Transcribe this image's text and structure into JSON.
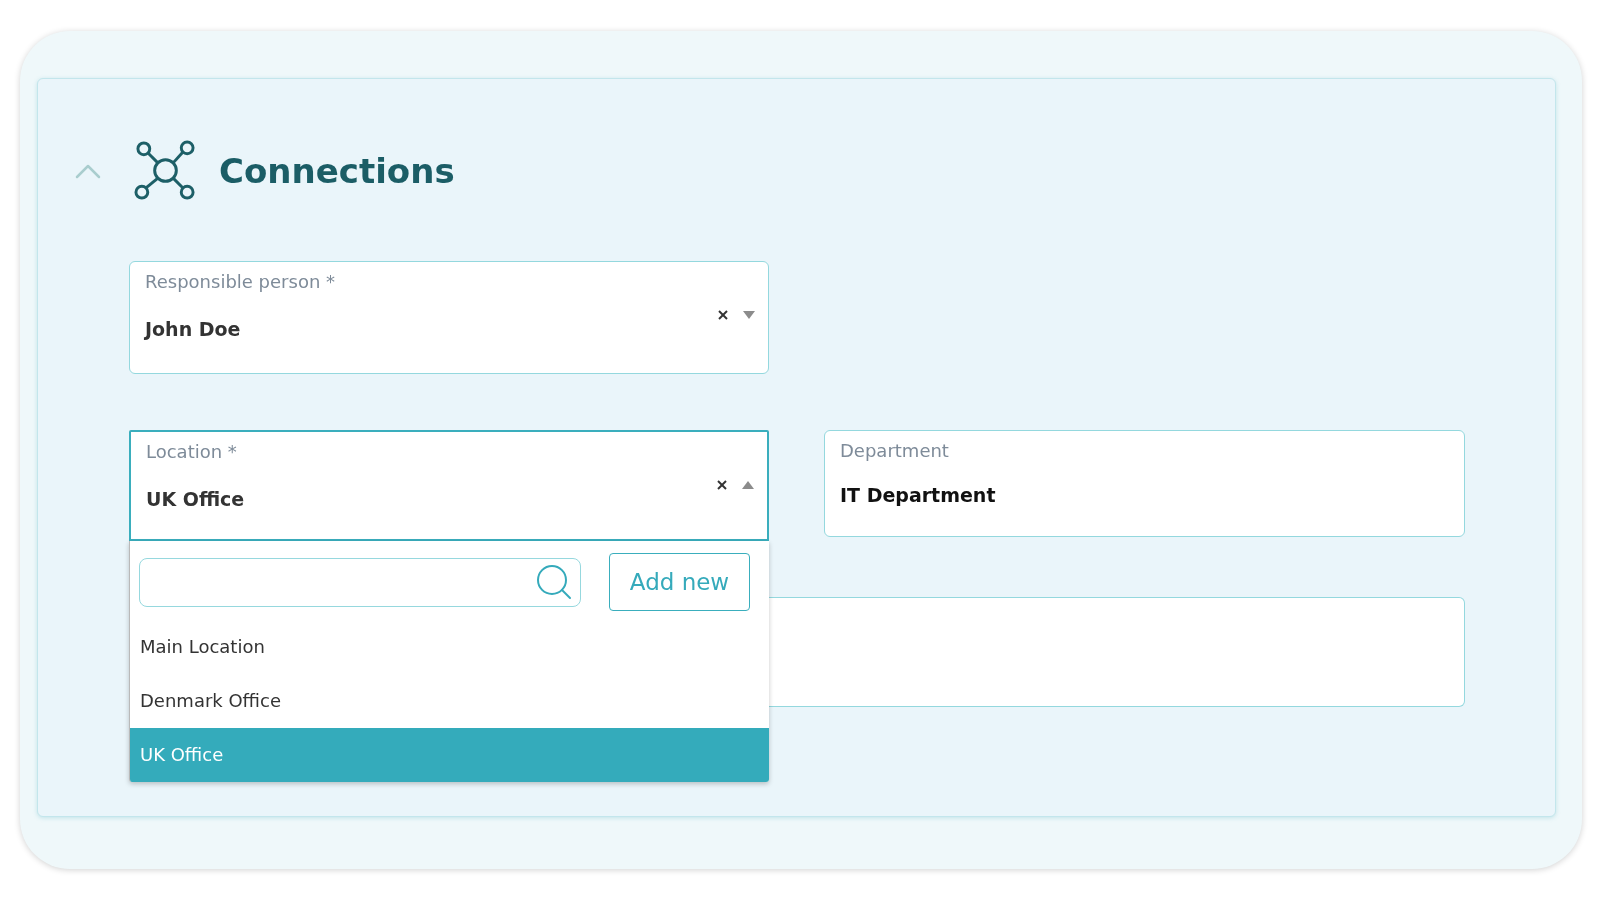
{
  "section": {
    "title": "Connections",
    "expanded": true
  },
  "fields": [
    {
      "kind": "select",
      "label": "Responsible person *",
      "value": "John Doe",
      "open": false
    },
    {
      "kind": "select",
      "label": "Location *",
      "value": "UK Office",
      "open": true,
      "dropdown": {
        "add_button": "Add new",
        "options": [
          {
            "label": "Main Location",
            "selected": false
          },
          {
            "label": "Denmark Office",
            "selected": false
          },
          {
            "label": "UK Office",
            "selected": true
          }
        ]
      }
    },
    {
      "kind": "text",
      "label": "Department",
      "value": "IT Department"
    },
    {
      "kind": "text"
    }
  ]
}
